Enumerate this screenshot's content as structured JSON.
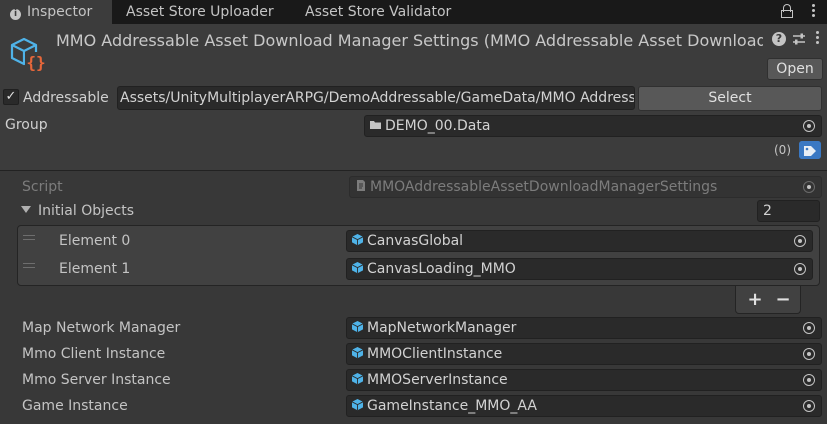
{
  "tabs": {
    "inspector": "Inspector",
    "uploader": "Asset Store Uploader",
    "validator": "Asset Store Validator"
  },
  "header": {
    "title": "MMO Addressable Asset Download Manager Settings (MMO Addressable Asset Download Manager Settings)",
    "open_label": "Open",
    "help_glyph": "?",
    "addressable_label": "Addressable",
    "addressable_checked": true,
    "check_glyph": "✓",
    "address": "Assets/UnityMultiplayerARPG/DemoAddressable/GameData/MMO Addressable Asset Download Manager Settings.asset",
    "select_label": "Select",
    "group_label": "Group",
    "group_value": "DEMO_00.Data",
    "labels_count": "(0)"
  },
  "body": {
    "script_label": "Script",
    "script_value": "MMOAddressableAssetDownloadManagerSettings",
    "initial_objects_label": "Initial Objects",
    "initial_objects_size": "2",
    "elements": [
      {
        "label": "Element 0",
        "value": "CanvasGlobal"
      },
      {
        "label": "Element 1",
        "value": "CanvasLoading_MMO"
      }
    ],
    "add_label": "+",
    "remove_label": "−",
    "fields": [
      {
        "label": "Map Network Manager",
        "value": "MapNetworkManager"
      },
      {
        "label": "Mmo Client Instance",
        "value": "MMOClientInstance"
      },
      {
        "label": "Mmo Server Instance",
        "value": "MMOServerInstance"
      },
      {
        "label": "Game Instance",
        "value": "GameInstance_MMO_AA"
      }
    ]
  },
  "colors": {
    "background": "#383838",
    "header": "#3c3c3c",
    "tab_bar": "#191919",
    "field": "#2a2a2a",
    "button": "#585858",
    "prefab_icon": "#4fb3e8",
    "asset_icon_cube": "#4fb3e8",
    "asset_icon_braces": "#e8673a",
    "label_tag": "#3a78c3"
  }
}
